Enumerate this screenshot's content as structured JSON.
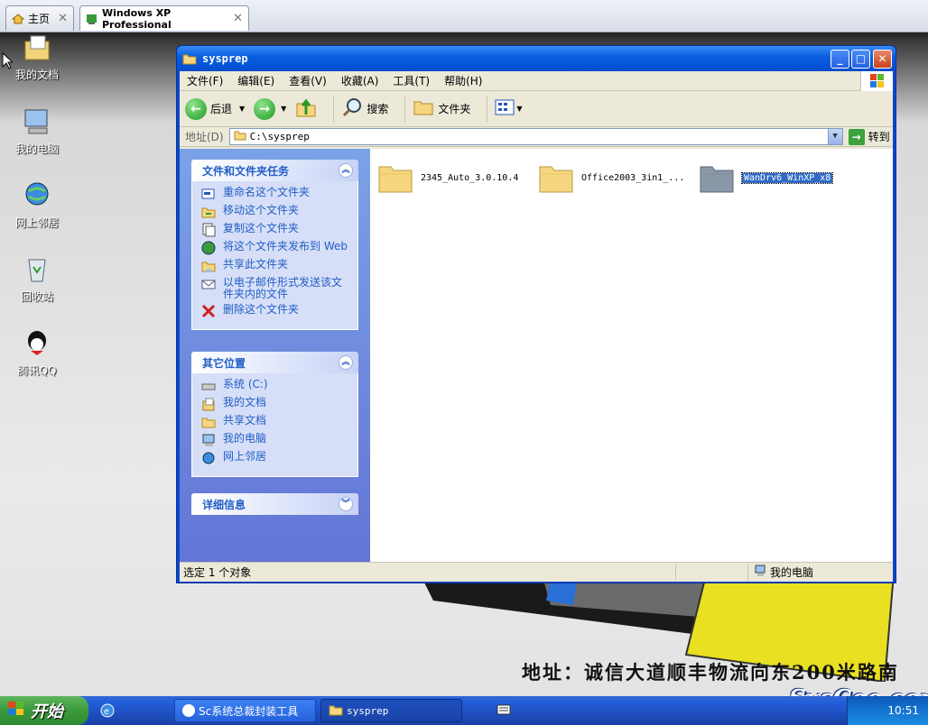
{
  "vm_tabs": [
    {
      "label": "主页"
    },
    {
      "label": "Windows XP Professional"
    }
  ],
  "desktop_icons": [
    {
      "label": "我的文档",
      "icon": "my-documents-icon"
    },
    {
      "label": "我的电脑",
      "icon": "my-computer-icon"
    },
    {
      "label": "网上邻居",
      "icon": "network-icon"
    },
    {
      "label": "回收站",
      "icon": "recycle-bin-icon"
    },
    {
      "label": "腾讯QQ",
      "icon": "qq-icon"
    }
  ],
  "window": {
    "title": "sysprep",
    "menus": [
      "文件(F)",
      "编辑(E)",
      "查看(V)",
      "收藏(A)",
      "工具(T)",
      "帮助(H)"
    ],
    "toolbar": {
      "back": "后退",
      "search": "搜索",
      "folders": "文件夹"
    },
    "address": {
      "label": "地址(D)",
      "value": "C:\\sysprep",
      "go": "转到"
    },
    "tasks_panel": {
      "title": "文件和文件夹任务",
      "items": [
        "重命名这个文件夹",
        "移动这个文件夹",
        "复制这个文件夹",
        "将这个文件夹发布到 Web",
        "共享此文件夹",
        "以电子邮件形式发送该文件夹内的文件",
        "删除这个文件夹"
      ]
    },
    "places_panel": {
      "title": "其它位置",
      "items": [
        "系统 (C:)",
        "我的文档",
        "共享文档",
        "我的电脑",
        "网上邻居"
      ]
    },
    "details_panel": {
      "title": "详细信息"
    },
    "files": [
      {
        "name": "2345_Auto_3.0.10.4",
        "selected": false
      },
      {
        "name": "Office2003_3in1_...",
        "selected": false
      },
      {
        "name": "WanDrv6_WinXP_x8",
        "selected": true
      }
    ],
    "status": {
      "left": "选定 1 个对象",
      "right": "我的电脑"
    }
  },
  "wallpaper": {
    "motto": "地址：诚信大道顺丰物流向东200米路南",
    "logo": "SysCeo.com"
  },
  "taskbar": {
    "start": "开始",
    "tasks": [
      "Sc系统总裁封装工具",
      "sysprep"
    ],
    "clock": "10:51"
  },
  "colors": {
    "xp_blue": "#0a5fe0",
    "panel_text": "#215dc6",
    "start_green": "#3c9a3c"
  }
}
